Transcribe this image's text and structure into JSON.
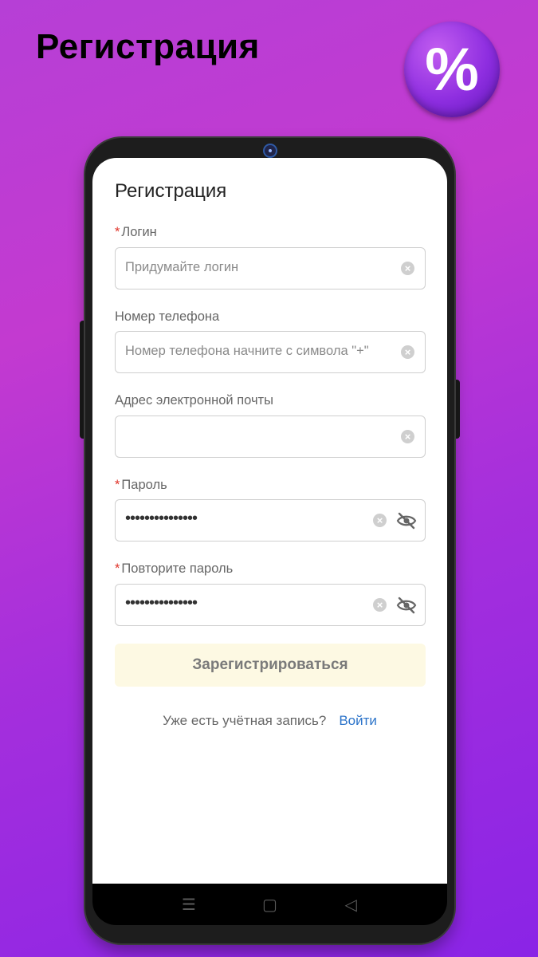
{
  "promo": {
    "title": "Регистрация",
    "badge_symbol": "%"
  },
  "form": {
    "title": "Регистрация",
    "fields": [
      {
        "label": "Логин",
        "required": true,
        "placeholder": "Придумайте логин",
        "value": ""
      },
      {
        "label": "Номер телефона",
        "required": false,
        "placeholder": "Номер телефона начните с символа \"+\"",
        "value": ""
      },
      {
        "label": "Адрес электронной почты",
        "required": false,
        "placeholder": "",
        "value": ""
      },
      {
        "label": "Пароль",
        "required": true,
        "placeholder": "",
        "value": "•••••••••••••••"
      },
      {
        "label": "Повторите пароль",
        "required": true,
        "placeholder": "",
        "value": "•••••••••••••••"
      }
    ],
    "required_mark": "*",
    "submit_label": "Зарегистрироваться",
    "login_question": "Уже есть учётная запись?",
    "login_link": "Войти"
  },
  "navbar": {
    "menu_glyph": "☰",
    "home_glyph": "▢",
    "back_glyph": "◁"
  },
  "colors": {
    "accent_link": "#2b73c9",
    "required": "#e0342a",
    "submit_bg": "#fdf9e3"
  }
}
